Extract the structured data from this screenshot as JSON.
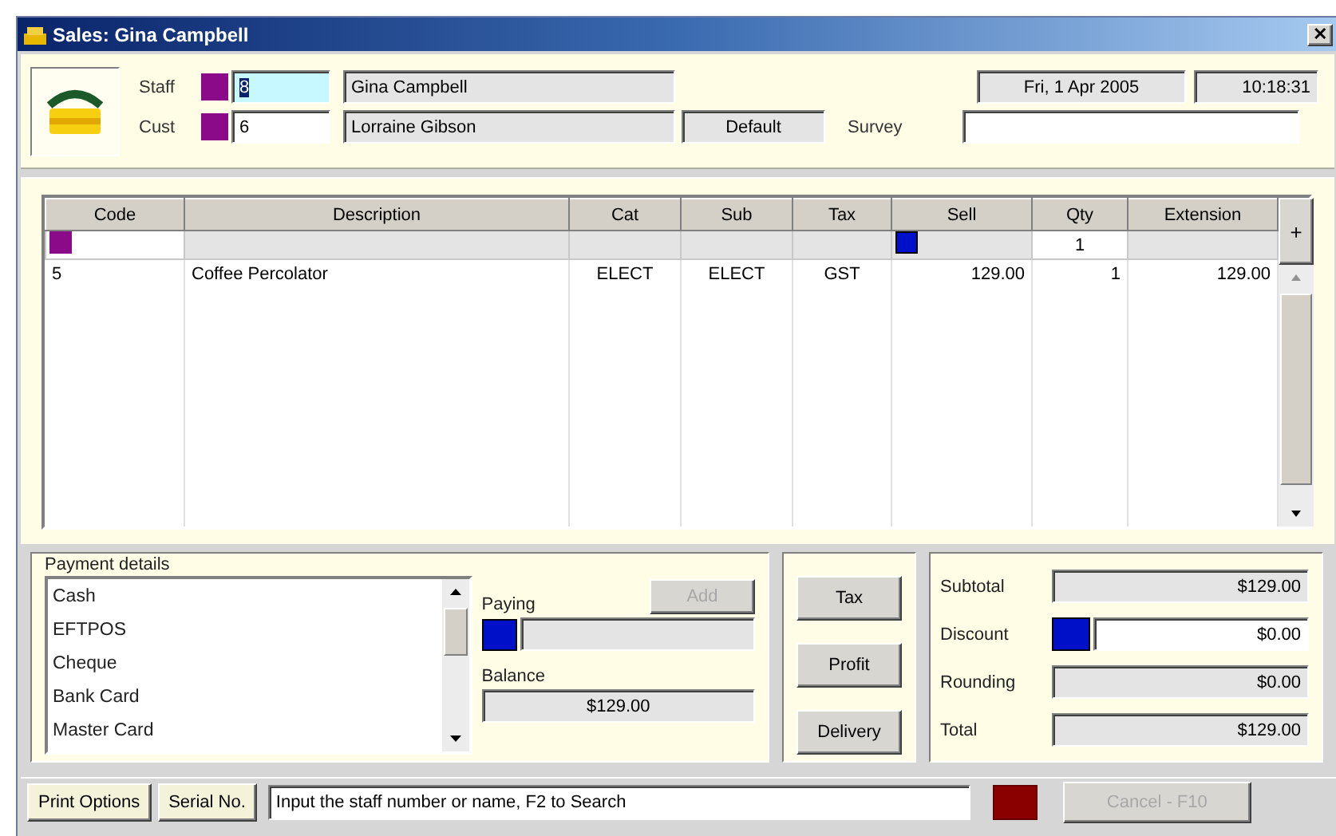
{
  "window": {
    "title": "Sales: Gina Campbell",
    "close_button": "✕"
  },
  "header": {
    "staff": {
      "label": "Staff",
      "number": "8",
      "name": "Gina Campbell"
    },
    "customer": {
      "label": "Cust",
      "number": "6",
      "name": "Lorraine Gibson",
      "price_level": "Default"
    },
    "survey": {
      "label": "Survey"
    },
    "date": "Fri, 1 Apr 2005",
    "time": "10:18:31"
  },
  "grid": {
    "columns": [
      {
        "label": "Code"
      },
      {
        "label": "Description"
      },
      {
        "label": "Cat"
      },
      {
        "label": "Sub"
      },
      {
        "label": "Tax"
      },
      {
        "label": "Sell"
      },
      {
        "label": "Qty"
      },
      {
        "label": "Extension"
      }
    ],
    "entry_qty": "1",
    "rows": [
      {
        "cells": [
          "5",
          "Coffee Percolator",
          "ELECT",
          "ELECT",
          "GST",
          "129.00",
          "1",
          "129.00"
        ]
      }
    ],
    "add_button": "+"
  },
  "payment": {
    "title": "Payment details",
    "methods": [
      {
        "label": "Cash"
      },
      {
        "label": "EFTPOS"
      },
      {
        "label": "Cheque"
      },
      {
        "label": "Bank Card"
      },
      {
        "label": "Master Card"
      }
    ],
    "paying_label": "Paying",
    "add_button": {
      "label": "Add",
      "disabled": true
    },
    "balance_label": "Balance",
    "balance": "$129.00"
  },
  "actions": [
    {
      "label": "Tax"
    },
    {
      "label": "Profit"
    },
    {
      "label": "Delivery"
    }
  ],
  "totals": [
    {
      "label": "Subtotal",
      "value": "$129.00",
      "kind": "readonly"
    },
    {
      "label": "Discount",
      "value": "$0.00",
      "kind": "editable"
    },
    {
      "label": "Rounding",
      "value": "$0.00",
      "kind": "readonly"
    },
    {
      "label": "Total",
      "value": "$129.00",
      "kind": "readonly"
    }
  ],
  "status_bar": {
    "buttons": [
      {
        "label": "Print Options"
      },
      {
        "label": "Serial No."
      }
    ],
    "message": "Input the staff number or name, F2 to Search",
    "cancel_button": {
      "label": "Cancel - F10",
      "disabled": true
    }
  }
}
